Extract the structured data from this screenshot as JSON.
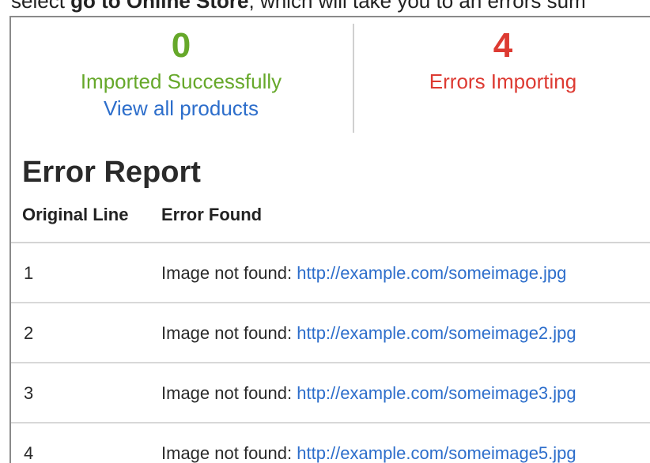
{
  "top_text": {
    "prefix": "select ",
    "bold": "go to Online Store",
    "suffix": ", which will take you to an errors sum"
  },
  "summary": {
    "imported_count": "0",
    "imported_label": "Imported Successfully",
    "view_all_link": "View all products",
    "error_count": "4",
    "error_label": "Errors Importing"
  },
  "report": {
    "title": "Error Report",
    "columns": {
      "original_line": "Original Line",
      "error_found": "Error Found"
    },
    "rows": [
      {
        "line": "1",
        "message": "Image not found: ",
        "url": "http://example.com/someimage.jpg"
      },
      {
        "line": "2",
        "message": "Image not found: ",
        "url": "http://example.com/someimage2.jpg"
      },
      {
        "line": "3",
        "message": "Image not found: ",
        "url": "http://example.com/someimage3.jpg"
      },
      {
        "line": "4",
        "message": "Image not found: ",
        "url": "http://example.com/someimage5.jpg"
      }
    ]
  },
  "colors": {
    "success": "#66a82a",
    "error": "#dd3a32",
    "link": "#2d6ecb"
  }
}
